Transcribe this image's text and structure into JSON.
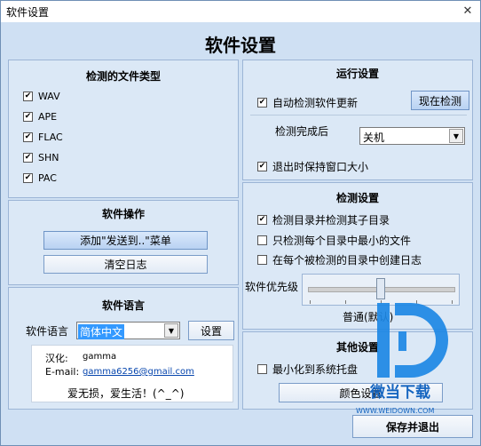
{
  "window": {
    "title": "软件设置",
    "close_glyph": "✕"
  },
  "main_title": "软件设置",
  "file_types": {
    "title": "检测的文件类型",
    "items": [
      {
        "label": "WAV",
        "checked": true
      },
      {
        "label": "APE",
        "checked": true
      },
      {
        "label": "FLAC",
        "checked": true
      },
      {
        "label": "SHN",
        "checked": true
      },
      {
        "label": "PAC",
        "checked": true
      }
    ]
  },
  "software_ops": {
    "title": "软件操作",
    "add_sendto_label": "添加\"发送到..\"菜单",
    "clear_log_label": "清空日志"
  },
  "language": {
    "title": "软件语言",
    "label": "软件语言",
    "selected": "简体中文",
    "setup_label": "设置",
    "credit_label": "汉化:",
    "credit_value": "gamma",
    "email_label": "E-mail:",
    "email_value": "gamma6256@gmail.com",
    "motto": "爱无损，爱生活！(^_^)"
  },
  "run_settings": {
    "title": "运行设置",
    "auto_update": {
      "label": "自动检测软件更新",
      "checked": true
    },
    "check_now_label": "现在检测",
    "after_label": "检测完成后",
    "after_selected": "关机",
    "keep_size": {
      "label": "退出时保持窗口大小",
      "checked": true
    }
  },
  "detect_settings": {
    "title": "检测设置",
    "options": [
      {
        "label": "检测目录并检测其子目录",
        "checked": true
      },
      {
        "label": "只检测每个目录中最小的文件",
        "checked": false
      },
      {
        "label": "在每个被检测的目录中创建日志",
        "checked": false
      }
    ],
    "priority_label": "软件优先级",
    "priority_value_label": "普通(默认)",
    "priority_level": 0.5
  },
  "other_settings": {
    "title": "其他设置",
    "minimize_tray": {
      "label": "最小化到系统托盘",
      "checked": false
    },
    "color_label": "颜色设置"
  },
  "save_exit_label": "保存并退出",
  "watermark": {
    "text": "微当下载",
    "url": "WWW.WEIDOWN.COM"
  },
  "colors": {
    "accent": "#1e88e5",
    "panel": "#dbe8f6",
    "window": "#cfe0f3"
  }
}
